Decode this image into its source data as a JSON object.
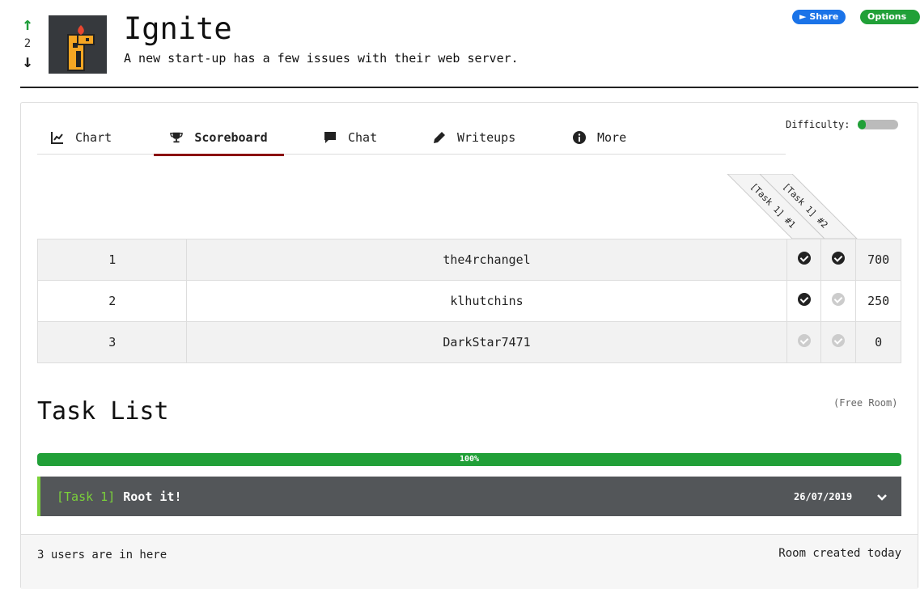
{
  "room": {
    "title": "Ignite",
    "subtitle": "A new start-up has a few issues with their web server.",
    "votes": "2",
    "share_label": "Share",
    "options_label": "Options"
  },
  "tabs": [
    {
      "label": "Chart",
      "icon": "chart-line-icon"
    },
    {
      "label": "Scoreboard",
      "icon": "trophy-icon",
      "active": true
    },
    {
      "label": "Chat",
      "icon": "chat-bubble-icon"
    },
    {
      "label": "Writeups",
      "icon": "pen-icon"
    },
    {
      "label": "More",
      "icon": "info-circle-icon"
    }
  ],
  "difficulty": {
    "label": "Difficulty:",
    "level": 0.2
  },
  "scoreboard": {
    "task_headers": [
      "[Task 1] #1",
      "[Task 1] #2"
    ],
    "rows": [
      {
        "rank": "1",
        "user": "the4rchangel",
        "task1": true,
        "task2": true,
        "points": "700"
      },
      {
        "rank": "2",
        "user": "klhutchins",
        "task1": true,
        "task2": false,
        "points": "250"
      },
      {
        "rank": "3",
        "user": "DarkStar7471",
        "task1": false,
        "task2": false,
        "points": "0"
      }
    ]
  },
  "task_list": {
    "title": "Task List",
    "room_type": "(Free Room)",
    "progress": "100%",
    "tasks": [
      {
        "tag": "[Task 1]",
        "name": "Root it!",
        "date": "26/07/2019"
      }
    ]
  },
  "footer": {
    "users_online": "3 users are in here",
    "created": "Room created today"
  },
  "colors": {
    "green": "#21a038",
    "blue": "#1a73e8",
    "task_bg": "#535659",
    "active_tab": "#8b0000"
  }
}
